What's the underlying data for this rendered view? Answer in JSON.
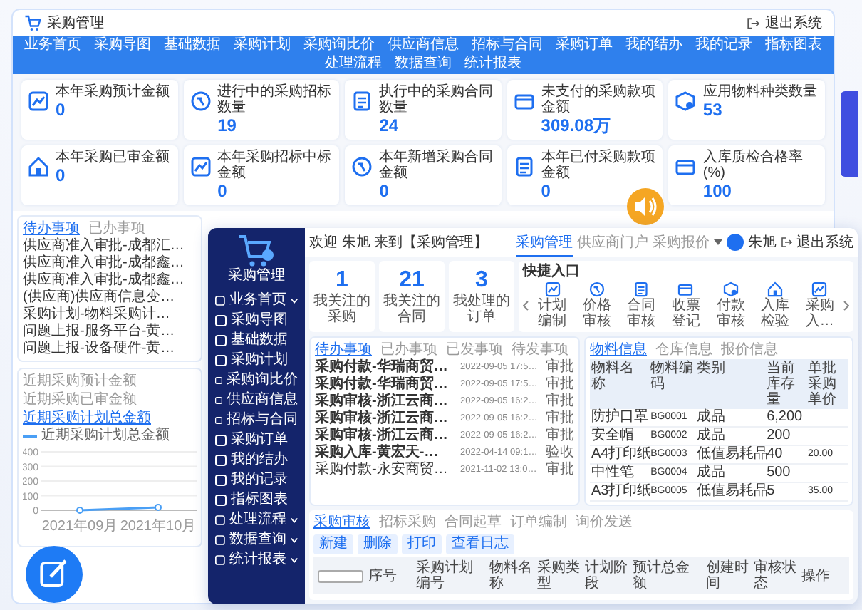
{
  "back_window": {
    "title": "采购管理",
    "logout": "退出系统",
    "nav": [
      "业务首页",
      "采购导图",
      "基础数据",
      "采购计划",
      "采购询比价",
      "供应商信息",
      "招标与合同",
      "采购订单",
      "我的结办",
      "我的记录",
      "指标图表",
      "处理流程",
      "数据查询",
      "统计报表"
    ],
    "stats": [
      {
        "label": "本年采购预计金额",
        "value": "0"
      },
      {
        "label": "进行中的采购招标数量",
        "value": "19"
      },
      {
        "label": "执行中的采购合同数量",
        "value": "24"
      },
      {
        "label": "未支付的采购款项金额",
        "value": "309.08万"
      },
      {
        "label": "应用物料种类数量",
        "value": "53"
      },
      {
        "label": "本年采购已审金额",
        "value": "0"
      },
      {
        "label": "本年采购招标中标金额",
        "value": "0"
      },
      {
        "label": "本年新增采购合同金额",
        "value": "0"
      },
      {
        "label": "本年已付采购款项金额",
        "value": "0"
      },
      {
        "label": "入库质检合格率(%)",
        "value": "100"
      }
    ],
    "todo_tabs": [
      {
        "label": "待办事项",
        "selected": true
      },
      {
        "label": "已办事项",
        "selected": false
      }
    ],
    "todo_items": [
      "供应商准入审批-成都汇…",
      "供应商准入审批-成都鑫…",
      "供应商准入审批-成都鑫…",
      "(供应商)供应商信息变…",
      "采购计划-物料采购计…",
      "问题上报-服务平台-黄…",
      "问题上报-设备硬件-黄…"
    ],
    "chart_tabs": [
      {
        "label": "近期采购预计金额",
        "selected": false
      },
      {
        "label": "近期采购已审金额",
        "selected": false
      },
      {
        "label": "近期采购计划总金额",
        "selected": true
      }
    ],
    "chart_data": {
      "type": "line",
      "x": [
        "2021年09月",
        "2021年10月"
      ],
      "yticks": [
        0,
        100,
        200,
        300,
        400
      ],
      "ylim": [
        0,
        400
      ],
      "grid": true,
      "series": [
        {
          "name": "近期采购计划总金额",
          "color": "#4a9ff5",
          "marker": true,
          "values": [
            0,
            20
          ]
        }
      ]
    }
  },
  "front_window": {
    "app_name": "采购管理",
    "menu": [
      {
        "label": "业务首页",
        "expandable": true
      },
      {
        "label": "采购导图",
        "expandable": false
      },
      {
        "label": "基础数据",
        "expandable": false
      },
      {
        "label": "采购计划",
        "expandable": false
      },
      {
        "label": "采购询比价",
        "expandable": false
      },
      {
        "label": "供应商信息",
        "expandable": false
      },
      {
        "label": "招标与合同",
        "expandable": false
      },
      {
        "label": "采购订单",
        "expandable": false
      },
      {
        "label": "我的结办",
        "expandable": false
      },
      {
        "label": "我的记录",
        "expandable": false
      },
      {
        "label": "指标图表",
        "expandable": false
      },
      {
        "label": "处理流程",
        "expandable": true
      },
      {
        "label": "数据查询",
        "expandable": true
      },
      {
        "label": "统计报表",
        "expandable": true
      }
    ],
    "welcome": "欢迎 朱旭 来到【采购管理】",
    "tabs": [
      {
        "label": "采购管理",
        "selected": true
      },
      {
        "label": "供应商门户",
        "selected": false
      },
      {
        "label": "采购报价",
        "selected": false
      }
    ],
    "user": "朱旭",
    "logout": "退出系统",
    "stats": [
      {
        "value": "1",
        "label": "我关注的采购"
      },
      {
        "value": "21",
        "label": "我关注的合同"
      },
      {
        "value": "3",
        "label": "我处理的订单"
      }
    ],
    "quick_entry": {
      "title": "快捷入口",
      "items": [
        "计划编制",
        "价格审核",
        "合同审核",
        "收票登记",
        "付款审核",
        "入库检验",
        "采购入…"
      ]
    },
    "todo": {
      "tabs": [
        {
          "label": "待办事项",
          "selected": true
        },
        {
          "label": "已办事项",
          "selected": false
        },
        {
          "label": "已发事项",
          "selected": false
        },
        {
          "label": "待发事项",
          "selected": false
        }
      ],
      "rows": [
        {
          "title": "采购付款-华瑞商贸…",
          "date": "2022-09-05 17:5…",
          "status": "审批",
          "unread": true
        },
        {
          "title": "采购付款-华瑞商贸…",
          "date": "2022-09-05 17:5…",
          "status": "审批",
          "unread": true
        },
        {
          "title": "采购审核-浙江云商…",
          "date": "2022-09-05 16:2…",
          "status": "审批",
          "unread": true
        },
        {
          "title": "采购审核-浙江云商…",
          "date": "2022-09-05 16:2…",
          "status": "审批",
          "unread": true
        },
        {
          "title": "采购审核-浙江云商…",
          "date": "2022-09-05 16:2…",
          "status": "审批",
          "unread": true
        },
        {
          "title": "采购入库-黄宏天-…",
          "date": "2022-04-14 09:1…",
          "status": "验收",
          "unread": true
        },
        {
          "title": "采购付款-永安商贸…",
          "date": "2021-11-02 13:0…",
          "status": "审批",
          "unread": false
        }
      ]
    },
    "materials": {
      "tabs": [
        {
          "label": "物料信息",
          "selected": true
        },
        {
          "label": "仓库信息",
          "selected": false
        },
        {
          "label": "报价信息",
          "selected": false
        }
      ],
      "columns": [
        "物料名称",
        "物料编码",
        "类别",
        "当前库存量",
        "单批采购单价"
      ],
      "rows": [
        [
          "防护口罩",
          "BG0001",
          "成品",
          "6,200",
          ""
        ],
        [
          "安全帽",
          "BG0002",
          "成品",
          "200",
          ""
        ],
        [
          "A4打印纸",
          "BG0003",
          "低值易耗品",
          "40",
          "20.00"
        ],
        [
          "中性笔",
          "BG0004",
          "成品",
          "500",
          ""
        ],
        [
          "A3打印纸",
          "BG0005",
          "低值易耗品",
          "5",
          "35.00"
        ]
      ]
    },
    "audit": {
      "tabs": [
        {
          "label": "采购审核",
          "selected": true
        },
        {
          "label": "招标采购",
          "selected": false
        },
        {
          "label": "合同起草",
          "selected": false
        },
        {
          "label": "订单编制",
          "selected": false
        },
        {
          "label": "询价发送",
          "selected": false
        }
      ],
      "buttons": [
        "新建",
        "删除",
        "打印",
        "查看日志"
      ],
      "select_all_checked": false,
      "columns": [
        "序号",
        "采购计划编号",
        "物料名称",
        "采购类型",
        "计划阶段",
        "预计总金额",
        "创建时间",
        "审核状态",
        "操作"
      ]
    }
  }
}
